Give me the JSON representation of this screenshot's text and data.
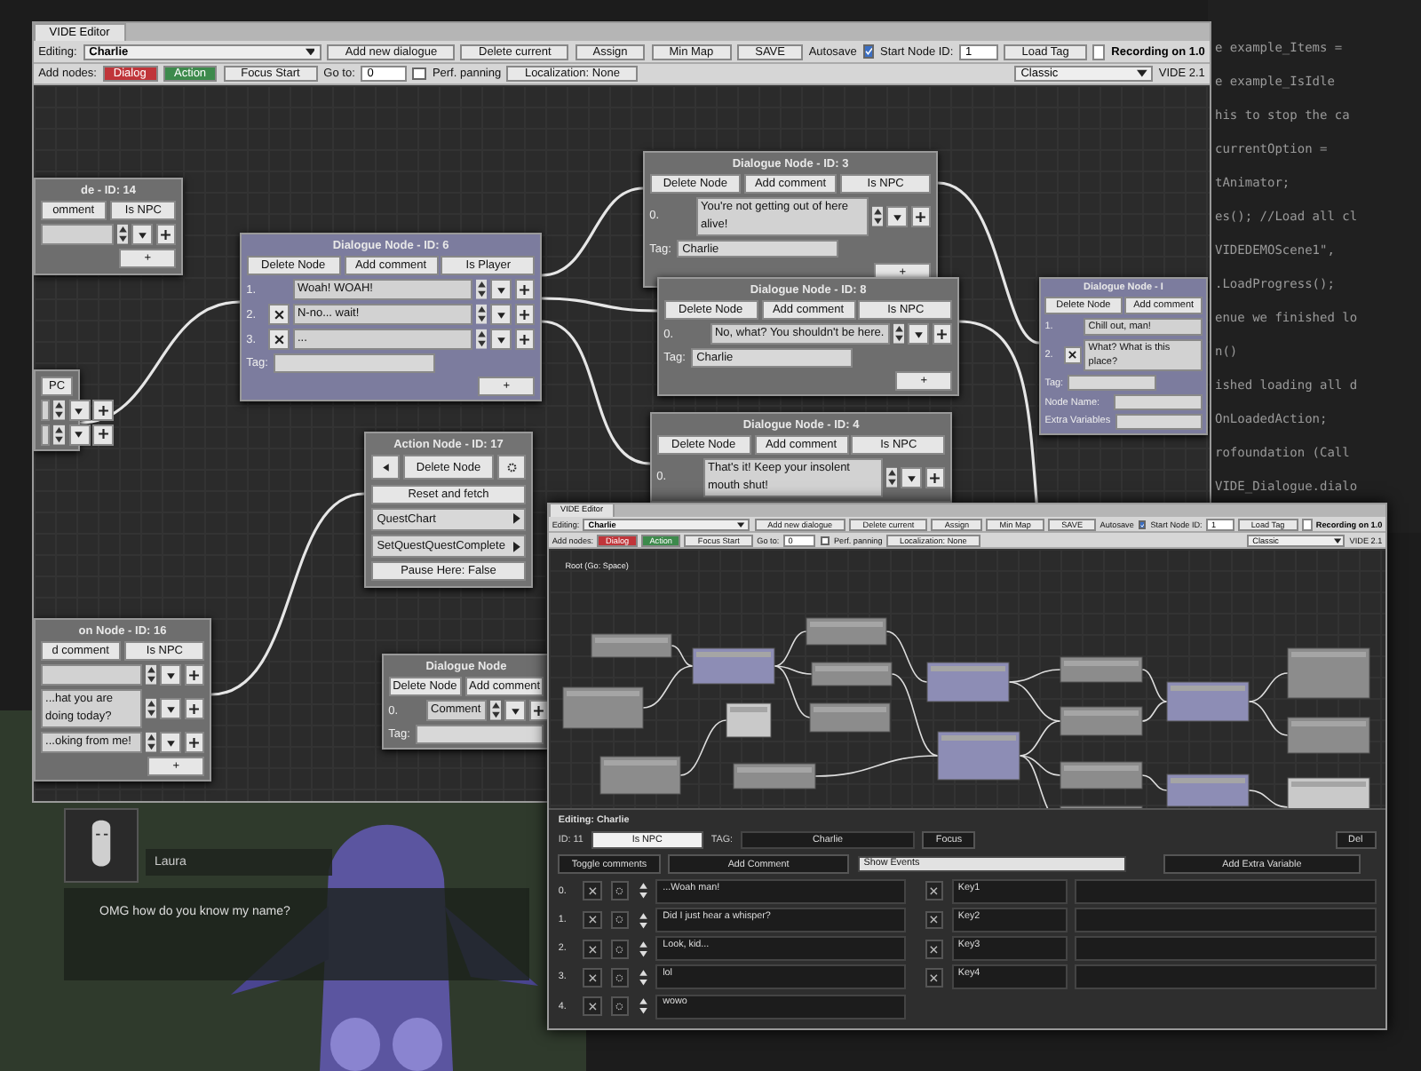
{
  "code_editor": {
    "lines": [
      "e example_Items =",
      "e example_IsIdle",
      "his to stop the ca",
      "currentOption =",
      "tAnimator;",
      "es(); //Load all cl",
      "VIDEDEMOScene1\", ",
      ".LoadProgress();",
      "enue we finished lo",
      "n()",
      "ished loading all d",
      "OnLoadedAction;",
      "rofoundation (Call",
      "VIDE_Dialogue.dialo"
    ]
  },
  "game_view": {
    "speaker": "Laura",
    "text": "OMG how do you know my name?"
  },
  "windows": [
    {
      "kind": "node_editor",
      "title": "VIDE Editor",
      "toolbar": {
        "editing_label": "Editing:",
        "dialogue": "Charlie",
        "buttons": [
          "Add new dialogue",
          "Delete current",
          "Assign",
          "Min Map",
          "SAVE"
        ],
        "autosave": {
          "label": "Autosave",
          "checked": true
        },
        "start_node": {
          "label": "Start Node ID:",
          "value": "1"
        },
        "load_tag": "Load Tag",
        "status": "Recording on 1.0",
        "add_label": "Add nodes:",
        "add_buttons": [
          {
            "label": "Dialog",
            "color": "#c0353a"
          },
          {
            "label": "Action",
            "color": "#3d8a4c"
          }
        ],
        "focus": "Focus Start",
        "goto": {
          "label": "Go to:",
          "value": "0"
        },
        "perf_panning": {
          "label": "Perf. panning",
          "checked": false
        },
        "localization": "Localization: None",
        "mode": "Classic",
        "version": "VIDE 2.1"
      },
      "nodes": [
        {
          "kind": "dialogue",
          "color": "#6e6e6e",
          "title": "de - ID: 14",
          "buttons": [
            "omment",
            "Is NPC"
          ],
          "lines": [
            {
              "kind": "blank"
            }
          ],
          "add_label": "+"
        },
        {
          "kind": "dialogue",
          "color": "#7c7c9e",
          "title": "Dialogue Node - ID: 6",
          "buttons": [
            "Delete Node",
            "Add comment",
            "Is Player"
          ],
          "lines": [
            {
              "kind": "text",
              "number": "1.",
              "text": "Woah! WOAH!",
              "removable": false
            },
            {
              "kind": "text",
              "number": "2.",
              "text": "N-no... wait!",
              "removable": true
            },
            {
              "kind": "text",
              "number": "3.",
              "text": "...",
              "removable": true
            }
          ],
          "tag": {
            "label": "Tag:"
          },
          "add_label": "+"
        },
        {
          "kind": "dialogue",
          "color": "#6e6e6e",
          "title": "Dialogue Node - ID: 3",
          "buttons": [
            "Delete Node",
            "Add comment",
            "Is NPC"
          ],
          "lines": [
            {
              "kind": "text",
              "number": "0.",
              "text": "You're not getting out of here alive!"
            }
          ],
          "tag": {
            "label": "Tag:",
            "value": "Charlie"
          },
          "add_label": "+"
        },
        {
          "kind": "dialogue",
          "color": "#6e6e6e",
          "title": "Dialogue Node - ID: 8",
          "buttons": [
            "Delete Node",
            "Add comment",
            "Is NPC"
          ],
          "lines": [
            {
              "kind": "text",
              "number": "0.",
              "text": "No, what? You shouldn't be here."
            }
          ],
          "tag": {
            "label": "Tag:",
            "value": "Charlie"
          },
          "add_label": "+"
        },
        {
          "kind": "dialogue",
          "color": "#6e6e6e",
          "title": "Dialogue Node - ID: 4",
          "buttons": [
            "Delete Node",
            "Add comment",
            "Is NPC"
          ],
          "lines": [
            {
              "kind": "text",
              "number": "0.",
              "text": "That's it! Keep your insolent mouth shut!"
            }
          ]
        },
        {
          "kind": "dialogue",
          "color": "#7c7c9e",
          "title": "Dialogue Node - I",
          "buttons": [
            "Delete Node",
            "Add comment"
          ],
          "lines": [
            {
              "kind": "text",
              "number": "1.",
              "text": "Chill out, man!",
              "removable": false
            },
            {
              "kind": "text",
              "number": "2.",
              "text": "What? What is this place?",
              "removable": true
            }
          ],
          "tag": {
            "label": "Tag:"
          },
          "extras": [
            "Node Name:",
            "Extra Variables"
          ]
        },
        {
          "kind": "action",
          "color": "#737373",
          "title": "Action Node - ID: 17",
          "buttons": [
            "Delete Node",
            "Reset and fetch"
          ],
          "dropdowns": [
            "QuestChart",
            "SetQuestQuestComplete"
          ],
          "pause": "Pause Here: False"
        },
        {
          "kind": "dialogue",
          "color": "#6e6e6e",
          "buttons": [
            "PC"
          ],
          "lines": [
            {
              "kind": "blank"
            },
            {
              "kind": "blank"
            }
          ]
        },
        {
          "kind": "dialogue",
          "color": "#6e6e6e",
          "title": "on Node - ID: 16",
          "buttons": [
            "d comment",
            "Is NPC"
          ],
          "lines": [
            {
              "kind": "blank"
            },
            {
              "kind": "text",
              "text": "...hat you are doing today?"
            },
            {
              "kind": "text",
              "text": "...oking from me!"
            }
          ],
          "add_label": "+"
        },
        {
          "kind": "dialogue",
          "color": "#6e6e6e",
          "title": "Dialogue Node",
          "buttons": [
            "Delete Node",
            "Add comment"
          ],
          "lines": [
            {
              "kind": "text",
              "number": "0.",
              "text": "Comment"
            }
          ],
          "tag": {
            "label": "Tag:"
          }
        }
      ]
    },
    {
      "kind": "overview",
      "title": "VIDE Editor",
      "toolbar": {
        "editing_label": "Editing:",
        "dialogue": "Charlie",
        "buttons": [
          "Add new dialogue",
          "Delete current",
          "Assign",
          "Min Map",
          "SAVE"
        ],
        "autosave": {
          "label": "Autosave",
          "checked": true
        },
        "start_node": {
          "label": "Start Node ID:",
          "value": "1"
        },
        "load_tag": "Load Tag",
        "status": "Recording on 1.0",
        "add_label": "Add nodes:",
        "add_buttons": [
          {
            "label": "Dialog",
            "color": "#c0353a"
          },
          {
            "label": "Action",
            "color": "#3d8a4c"
          }
        ],
        "focus": "Focus Start",
        "goto": {
          "label": "Go to:",
          "value": "0"
        },
        "perf_panning": {
          "label": "Perf. panning",
          "checked": false
        },
        "localization": "Localization: None",
        "mode": "Classic",
        "version": "VIDE 2.1"
      },
      "canvas_label": "Root (Go: Space)",
      "panel": {
        "title": "Editing: Charlie",
        "id": "ID: 11",
        "npc_button": {
          "label": "Is NPC",
          "selected": true
        },
        "tag_label": "TAG:",
        "tag": "Charlie",
        "focus": "Focus",
        "delete": "Del",
        "toggle": "Toggle comments",
        "add_comment": "Add Comment",
        "events": "Show Events",
        "add_variable": "Add Extra Variable",
        "comments": [
          {
            "number": "0.",
            "text": "...Woah man!"
          },
          {
            "number": "1.",
            "text": "Did I just hear a whisper?"
          },
          {
            "number": "2.",
            "text": "Look, kid..."
          },
          {
            "number": "3.",
            "text": "lol"
          },
          {
            "number": "4.",
            "text": "wowo"
          }
        ],
        "variables": [
          "Key1",
          "Key2",
          "Key3",
          "Key4"
        ]
      }
    }
  ]
}
